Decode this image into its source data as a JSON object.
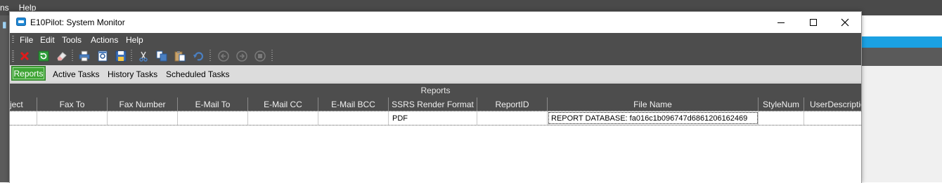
{
  "background_app": {
    "menu": [
      "ns",
      "Help"
    ]
  },
  "window": {
    "title": "E10Pilot: System Monitor",
    "controls": {
      "minimize": "minimize-icon",
      "maximize": "maximize-icon",
      "close": "close-icon"
    }
  },
  "menubar": {
    "items": [
      "File",
      "Edit",
      "Tools",
      "Actions",
      "Help"
    ]
  },
  "toolbar": {
    "buttons": [
      "delete-icon",
      "refresh-icon",
      "clear-icon",
      "print-icon",
      "print-preview-icon",
      "save-icon",
      "cut-icon",
      "copy-icon",
      "paste-icon",
      "undo-icon",
      "back-icon",
      "forward-icon",
      "stop-icon"
    ]
  },
  "tabs": {
    "active": "Reports",
    "items": [
      "Reports",
      "Active Tasks",
      "History Tasks",
      "Scheduled Tasks"
    ]
  },
  "grid": {
    "title": "Reports",
    "columns": [
      "ject",
      "Fax To",
      "Fax Number",
      "E-Mail To",
      "E-Mail CC",
      "E-Mail BCC",
      "SSRS Render Format",
      "ReportID",
      "File Name",
      "StyleNum",
      "UserDescriptio"
    ],
    "rows": [
      [
        "",
        "",
        "",
        "",
        "",
        "",
        "PDF",
        "",
        "REPORT DATABASE: fa016c1b096747d6861206162469",
        "",
        ""
      ]
    ]
  },
  "colors": {
    "dark_bar": "#4d4d4d",
    "active_tab": "#3fa535",
    "accent_blue": "#1ba1e2"
  }
}
